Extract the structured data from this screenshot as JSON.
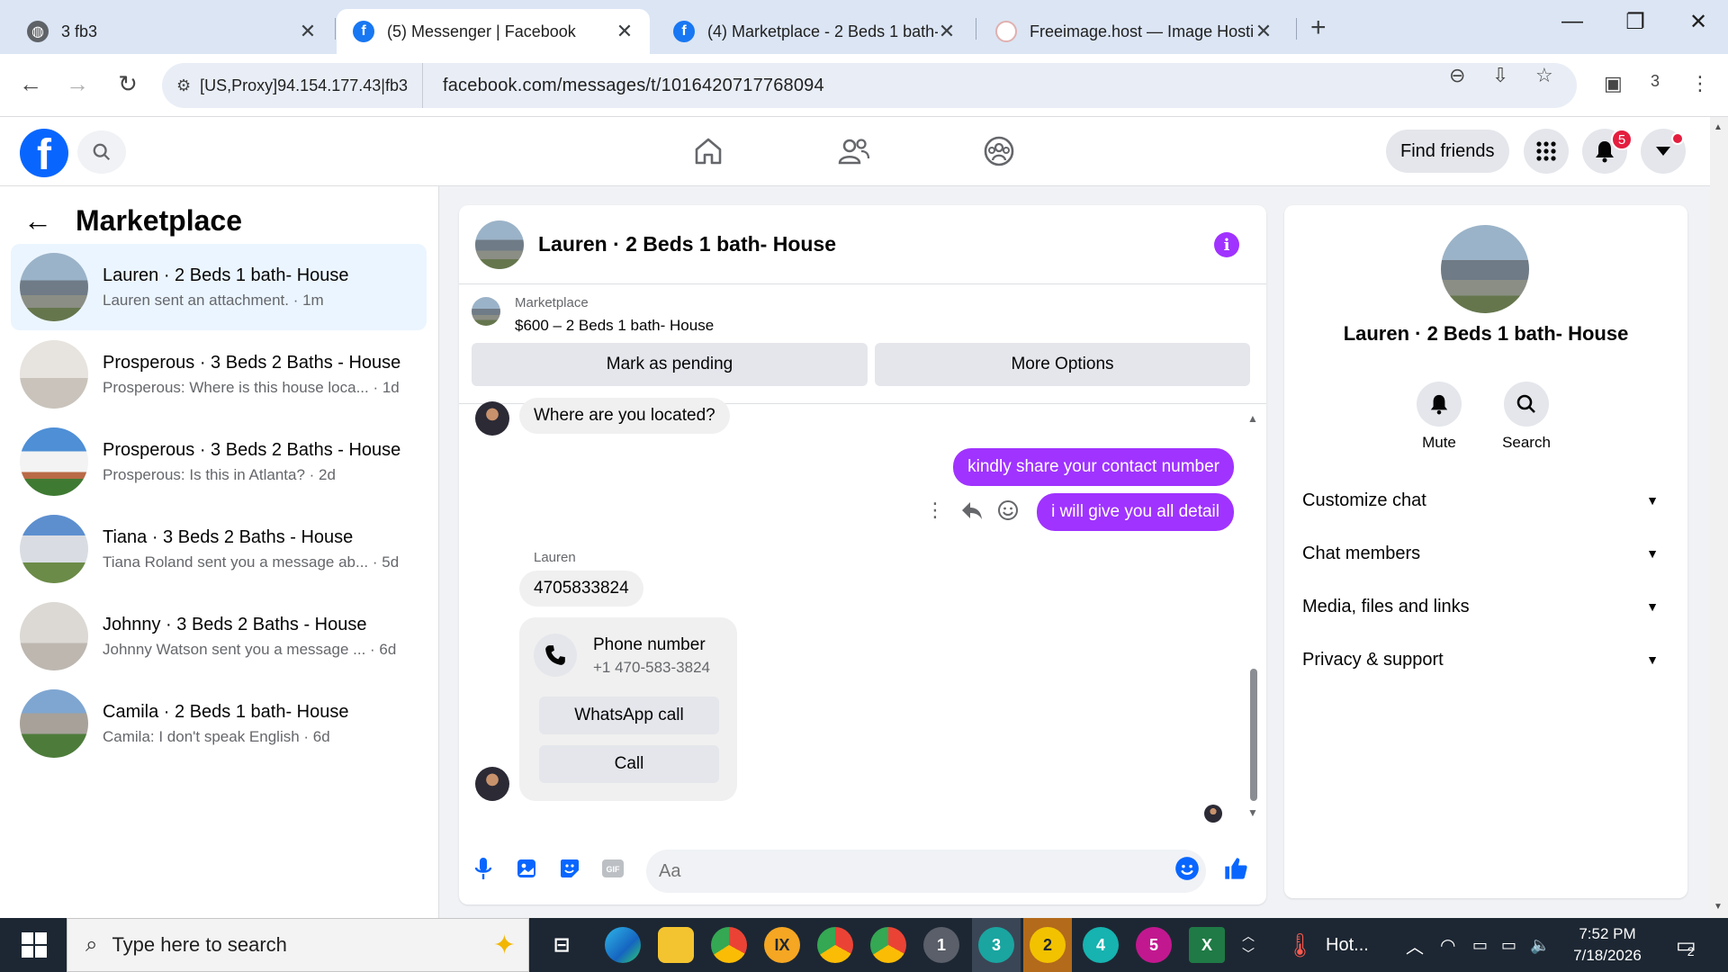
{
  "browser": {
    "tabs": [
      {
        "title": "3 fb3",
        "icon": "globe-icon"
      },
      {
        "title": "(5) Messenger | Facebook",
        "icon": "facebook-icon"
      },
      {
        "title": "(4) Marketplace - 2 Beds 1 bath- House",
        "icon": "facebook-icon"
      },
      {
        "title": "Freeimage.host — Image Hosting",
        "icon": "freeimage-icon"
      }
    ],
    "proxy_label": "[US,Proxy]94.154.177.43|fb3",
    "url": "facebook.com/messages/t/10164207177680‌94",
    "extension_count": "3"
  },
  "fb_header": {
    "find_friends": "Find friends",
    "notification_count": "5"
  },
  "sidebar": {
    "title": "Marketplace",
    "conversations": [
      {
        "name": "Lauren · 2 Beds 1 bath- House",
        "preview": "Lauren sent an attachment. · 1m"
      },
      {
        "name": "Prosperous · 3 Beds 2 Baths - House",
        "preview": "Prosperous: Where is this house loca... · 1d"
      },
      {
        "name": "Prosperous · 3 Beds 2 Baths - House",
        "preview": "Prosperous: Is this in Atlanta? · 2d"
      },
      {
        "name": "Tiana · 3 Beds 2 Baths - House",
        "preview": "Tiana Roland sent you a message ab... · 5d"
      },
      {
        "name": "Johnny · 3 Beds 2 Baths - House",
        "preview": "Johnny Watson sent you a message ... · 6d"
      },
      {
        "name": "Camila · 2 Beds 1 bath- House",
        "preview": "Camila: I don't speak English · 6d"
      }
    ]
  },
  "chat": {
    "title": "Lauren · 2 Beds 1 bath- House",
    "listing": {
      "label": "Marketplace",
      "price_title": "$600 – 2 Beds 1 bath- House",
      "mark_pending": "Mark as pending",
      "more_options": "More Options"
    },
    "messages": {
      "in_1": "Where are you located?",
      "out_1": "kindly share your contact number",
      "out_2": "i will give you all detail",
      "sender": "Lauren",
      "in_2": "4705833824"
    },
    "phone_card": {
      "title": "Phone number",
      "number": "+1 470-583-3824",
      "whatsapp": "WhatsApp call",
      "call": "Call"
    },
    "composer_placeholder": "Aa"
  },
  "info_panel": {
    "name": "Lauren · 2 Beds 1 bath- House",
    "mute": "Mute",
    "search": "Search",
    "sections": [
      "Customize chat",
      "Chat members",
      "Media, files and links",
      "Privacy & support"
    ]
  },
  "taskbar": {
    "search_placeholder": "Type here to search",
    "weather": "Hot...",
    "time": "7:52 PM",
    "date": "7/18/2026",
    "notif_count": "2",
    "app_badges": [
      "1",
      "3",
      "2",
      "4",
      "5"
    ]
  },
  "colors": {
    "fb_blue": "#0866ff",
    "messenger_purple": "#a033ff",
    "active_row": "#ebf5ff"
  }
}
